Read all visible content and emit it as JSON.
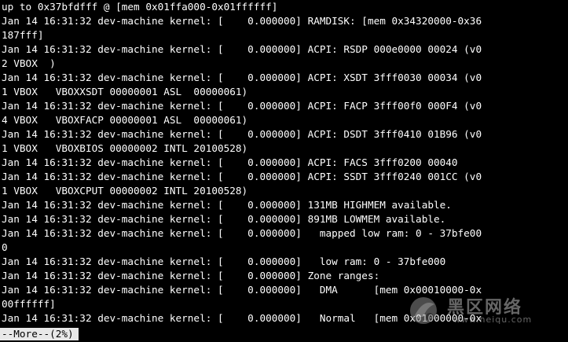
{
  "terminal": {
    "lines": [
      "up to 0x37bfdfff @ [mem 0x01ffa000-0x01ffffff]",
      "Jan 14 16:31:32 dev-machine kernel: [    0.000000] RAMDISK: [mem 0x34320000-0x36",
      "187fff]",
      "Jan 14 16:31:32 dev-machine kernel: [    0.000000] ACPI: RSDP 000e0000 00024 (v0",
      "2 VBOX  )",
      "Jan 14 16:31:32 dev-machine kernel: [    0.000000] ACPI: XSDT 3fff0030 00034 (v0",
      "1 VBOX   VBOXXSDT 00000001 ASL  00000061)",
      "Jan 14 16:31:32 dev-machine kernel: [    0.000000] ACPI: FACP 3fff00f0 000F4 (v0",
      "4 VBOX   VBOXFACP 00000001 ASL  00000061)",
      "Jan 14 16:31:32 dev-machine kernel: [    0.000000] ACPI: DSDT 3fff0410 01B96 (v0",
      "1 VBOX   VBOXBIOS 00000002 INTL 20100528)",
      "Jan 14 16:31:32 dev-machine kernel: [    0.000000] ACPI: FACS 3fff0200 00040",
      "Jan 14 16:31:32 dev-machine kernel: [    0.000000] ACPI: SSDT 3fff0240 001CC (v0",
      "1 VBOX   VBOXCPUT 00000002 INTL 20100528)",
      "Jan 14 16:31:32 dev-machine kernel: [    0.000000] 131MB HIGHMEM available.",
      "Jan 14 16:31:32 dev-machine kernel: [    0.000000] 891MB LOWMEM available.",
      "Jan 14 16:31:32 dev-machine kernel: [    0.000000]   mapped low ram: 0 - 37bfe00",
      "0",
      "Jan 14 16:31:32 dev-machine kernel: [    0.000000]   low ram: 0 - 37bfe000",
      "Jan 14 16:31:32 dev-machine kernel: [    0.000000] Zone ranges:",
      "Jan 14 16:31:32 dev-machine kernel: [    0.000000]   DMA      [mem 0x00010000-0x",
      "00ffffff]",
      "Jan 14 16:31:32 dev-machine kernel: [    0.000000]   Normal   [mem 0x01000000-0x"
    ]
  },
  "pager": {
    "prompt": "--More--(2%)"
  },
  "watermark": {
    "title": "黑区网络",
    "domain": "www.heiqu.com"
  }
}
